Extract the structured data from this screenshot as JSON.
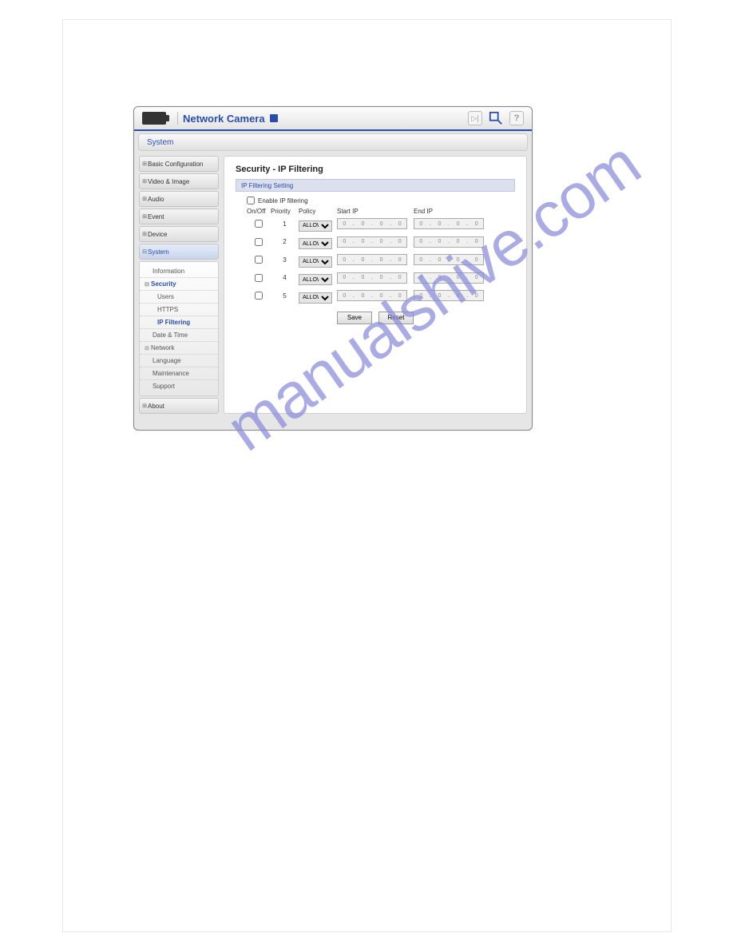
{
  "watermark": "manualshive.com",
  "header": {
    "title": "Network Camera",
    "breadcrumb": "System"
  },
  "sidebar": {
    "items": [
      {
        "label": "Basic Configuration"
      },
      {
        "label": "Video & Image"
      },
      {
        "label": "Audio"
      },
      {
        "label": "Event"
      },
      {
        "label": "Device"
      },
      {
        "label": "System",
        "active": true
      },
      {
        "label": "About"
      }
    ],
    "system_sub": {
      "information": "Information",
      "security": "Security",
      "users": "Users",
      "https": "HTTPS",
      "ipfiltering": "IP Filtering",
      "datetime": "Date & Time",
      "network": "Network",
      "language": "Language",
      "maintenance": "Maintenance",
      "support": "Support"
    }
  },
  "content": {
    "title": "Security - IP Filtering",
    "section": "IP Filtering Setting",
    "enable_label": "Enable IP filtering",
    "cols": {
      "onoff": "On/Off",
      "priority": "Priority",
      "policy": "Policy",
      "start": "Start IP",
      "end": "End IP"
    },
    "policy_option": "ALLOW",
    "rows": [
      {
        "priority": "1",
        "start": [
          "0",
          "0",
          "0",
          "0"
        ],
        "end": [
          "0",
          "0",
          "0",
          "0"
        ]
      },
      {
        "priority": "2",
        "start": [
          "0",
          "0",
          "0",
          "0"
        ],
        "end": [
          "0",
          "0",
          "0",
          "0"
        ]
      },
      {
        "priority": "3",
        "start": [
          "0",
          "0",
          "0",
          "0"
        ],
        "end": [
          "0",
          "0",
          "0",
          "0"
        ]
      },
      {
        "priority": "4",
        "start": [
          "0",
          "0",
          "0",
          "0"
        ],
        "end": [
          "0",
          "0",
          "0",
          "0"
        ]
      },
      {
        "priority": "5",
        "start": [
          "0",
          "0",
          "0",
          "0"
        ],
        "end": [
          "0",
          "0",
          "0",
          "0"
        ]
      }
    ],
    "save": "Save",
    "reset": "Reset"
  }
}
